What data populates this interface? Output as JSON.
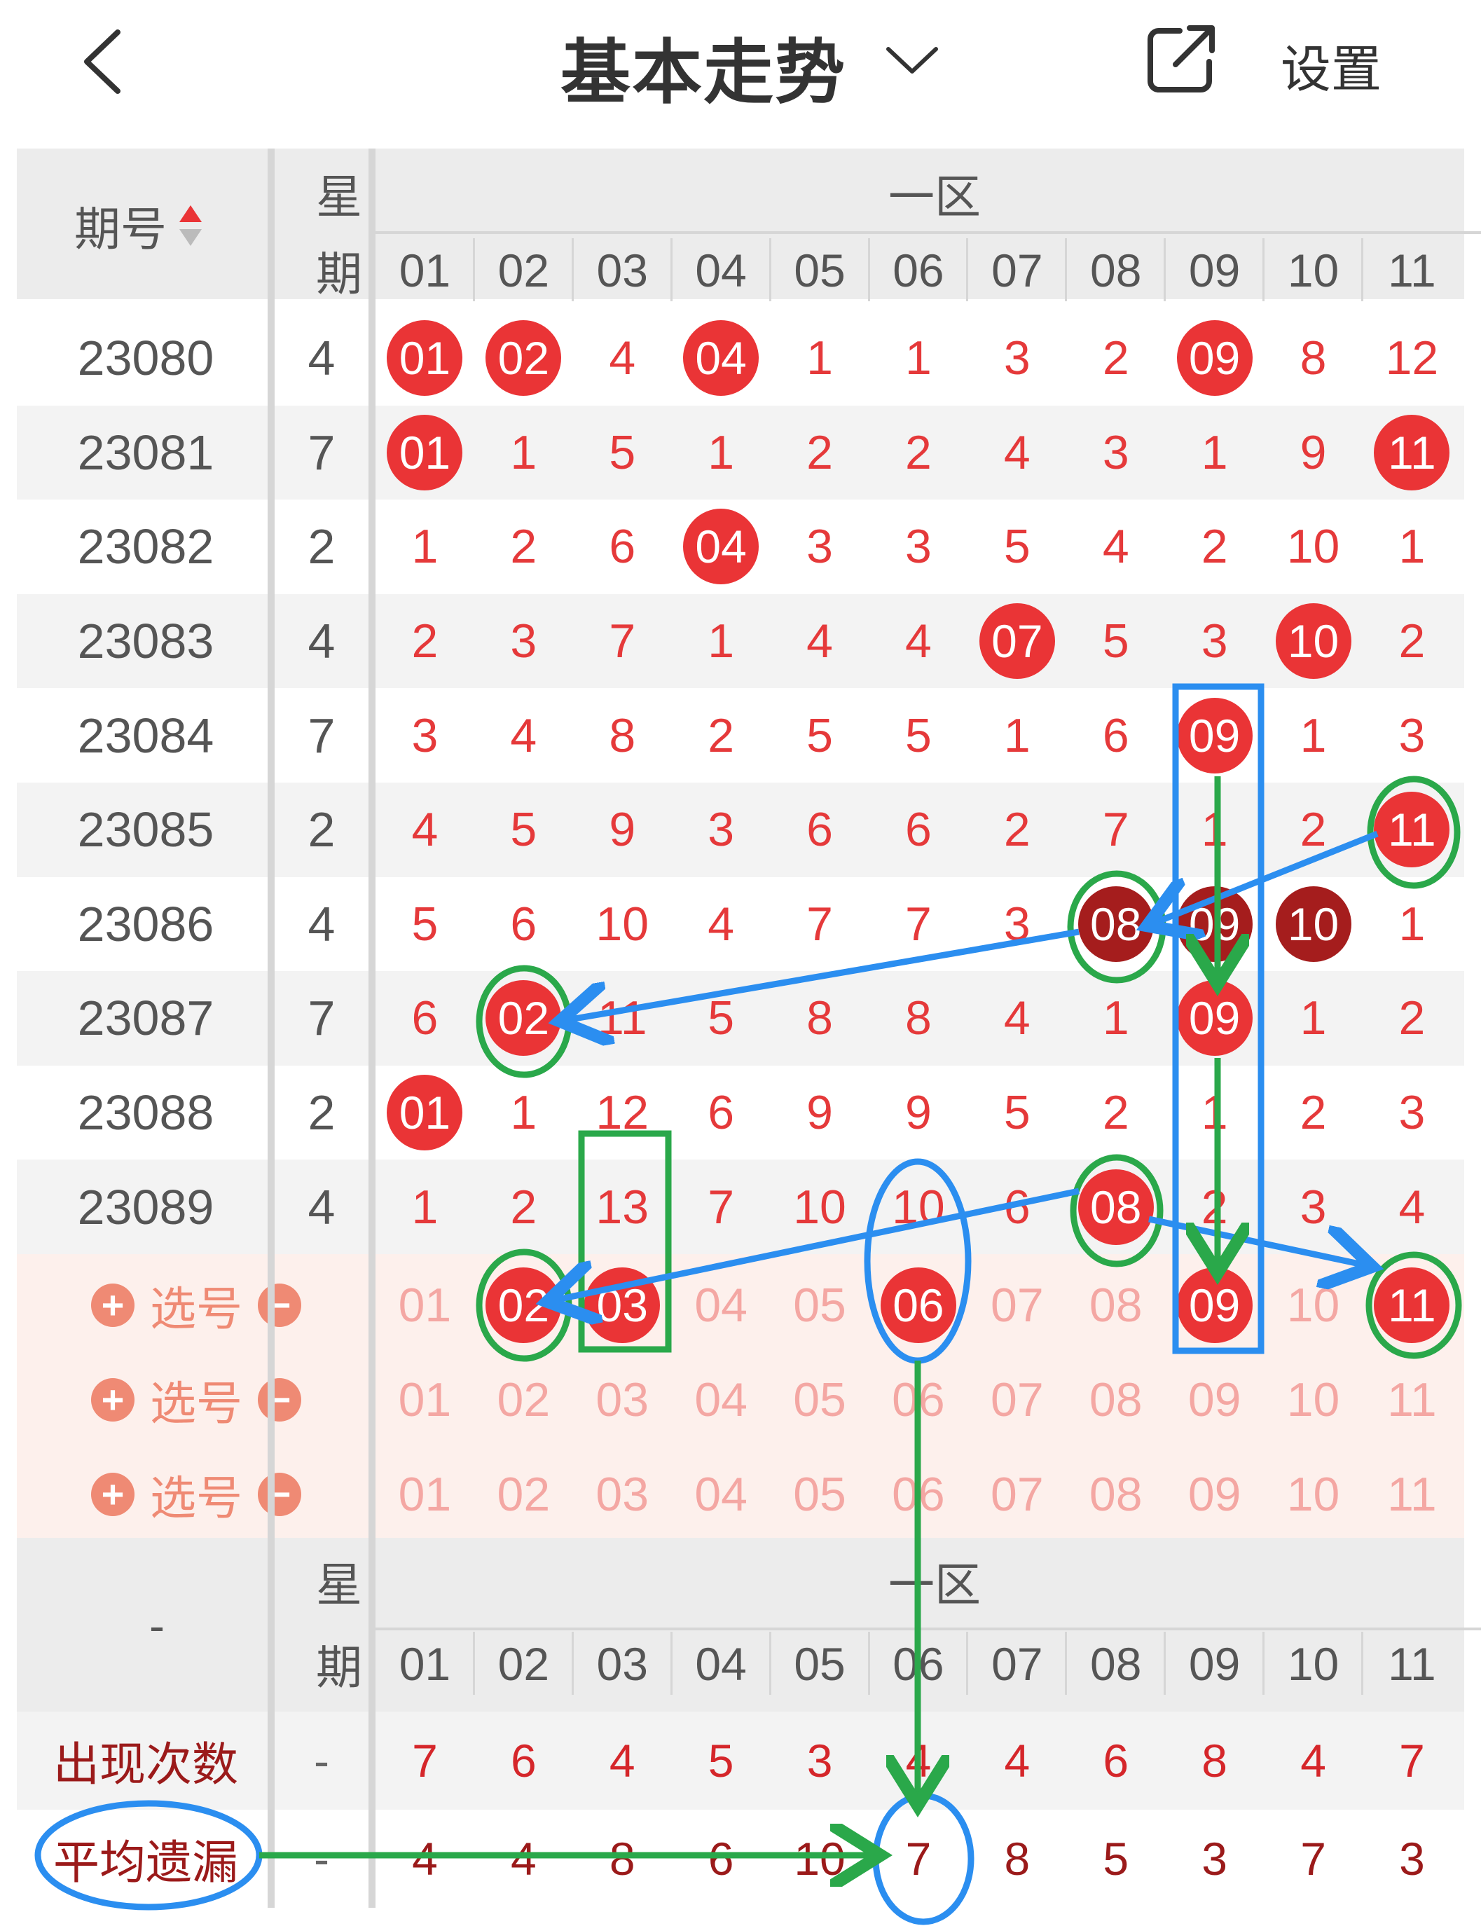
{
  "header": {
    "back_icon": "chevron-left-icon",
    "title": "基本走势",
    "title_dropdown_icon": "chevron-down-icon",
    "share_icon": "external-link-icon",
    "settings_label": "设置"
  },
  "table_header": {
    "period_label": "期号",
    "sort_icon": "sort-icon",
    "weekday_label_top": "星",
    "weekday_label_bottom": "期",
    "zone_label": "一区",
    "numbers": [
      "01",
      "02",
      "03",
      "04",
      "05",
      "06",
      "07",
      "08",
      "09",
      "10",
      "11"
    ]
  },
  "rows": [
    {
      "period": "23080",
      "weekday": "4",
      "cells": [
        "01",
        "02",
        "4",
        "04",
        "1",
        "1",
        "3",
        "2",
        "09",
        "8",
        "12"
      ]
    },
    {
      "period": "23081",
      "weekday": "7",
      "cells": [
        "01",
        "1",
        "5",
        "1",
        "2",
        "2",
        "4",
        "3",
        "1",
        "9",
        "11"
      ]
    },
    {
      "period": "23082",
      "weekday": "2",
      "cells": [
        "1",
        "2",
        "6",
        "04",
        "3",
        "3",
        "5",
        "4",
        "2",
        "10",
        "1"
      ]
    },
    {
      "period": "23083",
      "weekday": "4",
      "cells": [
        "2",
        "3",
        "7",
        "1",
        "4",
        "4",
        "07",
        "5",
        "3",
        "10",
        "2"
      ]
    },
    {
      "period": "23084",
      "weekday": "7",
      "cells": [
        "3",
        "4",
        "8",
        "2",
        "5",
        "5",
        "1",
        "6",
        "09",
        "1",
        "3"
      ]
    },
    {
      "period": "23085",
      "weekday": "2",
      "cells": [
        "4",
        "5",
        "9",
        "3",
        "6",
        "6",
        "2",
        "7",
        "1",
        "2",
        "11"
      ]
    },
    {
      "period": "23086",
      "weekday": "4",
      "cells": [
        "5",
        "6",
        "10",
        "4",
        "7",
        "7",
        "3",
        "08",
        "09",
        "10",
        "1"
      ]
    },
    {
      "period": "23087",
      "weekday": "7",
      "cells": [
        "6",
        "02",
        "11",
        "5",
        "8",
        "8",
        "4",
        "1",
        "09",
        "1",
        "2"
      ]
    },
    {
      "period": "23088",
      "weekday": "2",
      "cells": [
        "01",
        "1",
        "12",
        "6",
        "9",
        "9",
        "5",
        "2",
        "1",
        "2",
        "3"
      ]
    },
    {
      "period": "23089",
      "weekday": "4",
      "cells": [
        "1",
        "2",
        "13",
        "7",
        "10",
        "10",
        "6",
        "08",
        "2",
        "3",
        "4"
      ]
    }
  ],
  "hit_flags": [
    [
      1,
      1,
      0,
      1,
      0,
      0,
      0,
      0,
      1,
      0,
      0
    ],
    [
      1,
      0,
      0,
      0,
      0,
      0,
      0,
      0,
      0,
      0,
      1
    ],
    [
      0,
      0,
      0,
      1,
      0,
      0,
      0,
      0,
      0,
      0,
      0
    ],
    [
      0,
      0,
      0,
      0,
      0,
      0,
      1,
      0,
      0,
      1,
      0
    ],
    [
      0,
      0,
      0,
      0,
      0,
      0,
      0,
      0,
      1,
      0,
      0
    ],
    [
      0,
      0,
      0,
      0,
      0,
      0,
      0,
      0,
      0,
      0,
      1
    ],
    [
      0,
      0,
      0,
      0,
      0,
      0,
      0,
      2,
      2,
      2,
      0
    ],
    [
      0,
      1,
      0,
      0,
      0,
      0,
      0,
      0,
      1,
      0,
      0
    ],
    [
      1,
      0,
      0,
      0,
      0,
      0,
      0,
      0,
      0,
      0,
      0
    ],
    [
      0,
      0,
      0,
      0,
      0,
      0,
      0,
      1,
      0,
      0,
      0
    ]
  ],
  "pick_rows": [
    {
      "label": "选号",
      "plus_icon": "plus-circle-icon",
      "minus_icon": "minus-circle-icon",
      "cells": [
        "01",
        "02",
        "03",
        "04",
        "05",
        "06",
        "07",
        "08",
        "09",
        "10",
        "11"
      ],
      "selected": [
        2,
        3,
        6,
        9,
        11
      ]
    },
    {
      "label": "选号",
      "plus_icon": "plus-circle-icon",
      "minus_icon": "minus-circle-icon",
      "cells": [
        "01",
        "02",
        "03",
        "04",
        "05",
        "06",
        "07",
        "08",
        "09",
        "10",
        "11"
      ],
      "selected": []
    },
    {
      "label": "选号",
      "plus_icon": "plus-circle-icon",
      "minus_icon": "minus-circle-icon",
      "cells": [
        "01",
        "02",
        "03",
        "04",
        "05",
        "06",
        "07",
        "08",
        "09",
        "10",
        "11"
      ],
      "selected": []
    }
  ],
  "footer_header": {
    "dash": "-",
    "weekday_label_top": "星",
    "weekday_label_bottom": "期",
    "zone_label": "一区",
    "numbers": [
      "01",
      "02",
      "03",
      "04",
      "05",
      "06",
      "07",
      "08",
      "09",
      "10",
      "11"
    ]
  },
  "stats": [
    {
      "label": "出现次数",
      "weekday": "-",
      "values": [
        "7",
        "6",
        "4",
        "5",
        "3",
        "4",
        "4",
        "6",
        "8",
        "4",
        "7"
      ]
    },
    {
      "label": "平均遗漏",
      "weekday": "-",
      "values": [
        "4",
        "4",
        "8",
        "6",
        "10",
        "7",
        "8",
        "5",
        "3",
        "7",
        "3"
      ]
    }
  ],
  "colors": {
    "ball_red": "#ea3436",
    "ball_dark": "#a51d1d",
    "miss_text": "#e5393a",
    "annotation_blue": "#2b8ef0",
    "annotation_green": "#2aa84a",
    "pick_bg": "#fdf0ec"
  }
}
